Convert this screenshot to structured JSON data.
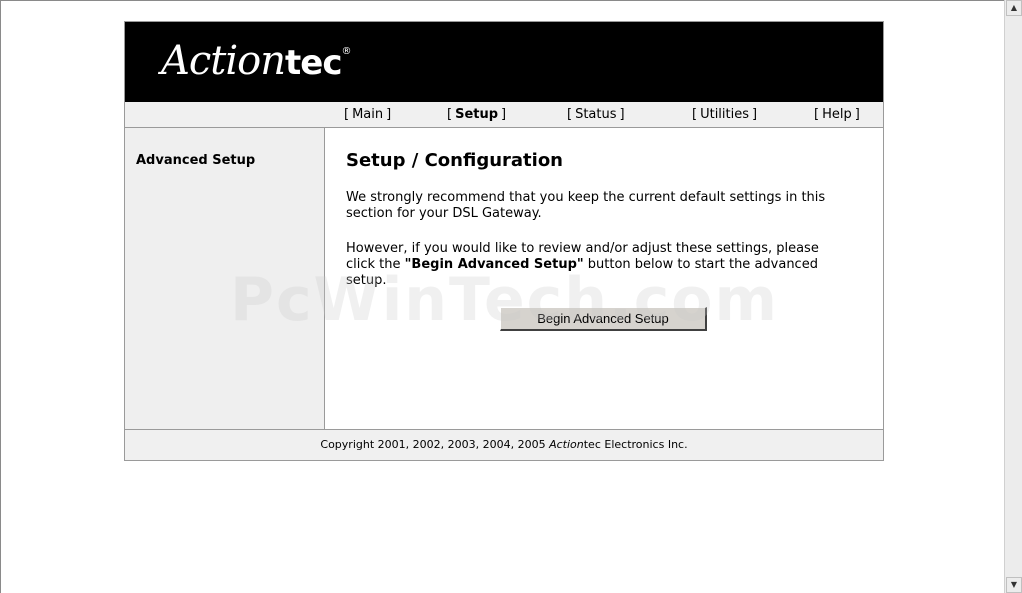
{
  "brand": {
    "logo_script": "Action",
    "logo_bold": "tec",
    "logo_reg": "®"
  },
  "nav": {
    "items": [
      {
        "bracket_open": "[",
        "label": "Main",
        "bracket_close": "]"
      },
      {
        "bracket_open": "[",
        "label": "Setup",
        "bracket_close": "]"
      },
      {
        "bracket_open": "[",
        "label": "Status",
        "bracket_close": "]"
      },
      {
        "bracket_open": "[",
        "label": "Utilities",
        "bracket_close": "]"
      },
      {
        "bracket_open": "[",
        "label": "Help",
        "bracket_close": "]"
      }
    ],
    "active": "Setup"
  },
  "sidebar": {
    "title": "Advanced Setup"
  },
  "main": {
    "title": "Setup / Configuration",
    "para1": "We strongly recommend that you keep the current default settings in this section for your DSL Gateway.",
    "para2_before": "However, if you would like to review and/or adjust these settings, please click the ",
    "para2_bold": "\"Begin Advanced Setup\"",
    "para2_after": " button below to start the advanced setup.",
    "button_label": "Begin Advanced Setup"
  },
  "footer": {
    "prefix": "Copyright 2001, 2002, 2003, 2004, 2005 ",
    "brand_italic": "Action",
    "brand_rest": "tec",
    "suffix": " Electronics Inc."
  },
  "watermark": "PcWinTech.com",
  "scrollbar": {
    "up_icon": "▲",
    "down_icon": "▼"
  }
}
